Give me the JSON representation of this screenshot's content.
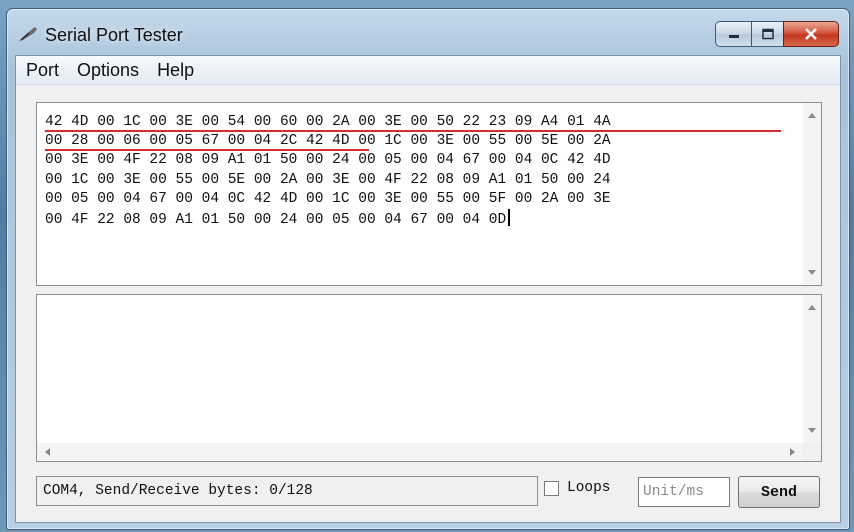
{
  "window": {
    "title": "Serial Port Tester"
  },
  "menu": [
    "Port",
    "Options",
    "Help"
  ],
  "receive_text": [
    "42 4D 00 1C 00 3E 00 54 00 60 00 2A 00 3E 00 50 22 23 09 A4 01 4A",
    "00 28 00 06 00 05 67 00 04 2C 42 4D 00 1C 00 3E 00 55 00 5E 00 2A",
    "00 3E 00 4F 22 08 09 A1 01 50 00 24 00 05 00 04 67 00 04 0C 42 4D",
    "00 1C 00 3E 00 55 00 5E 00 2A 00 3E 00 4F 22 08 09 A1 01 50 00 24",
    "00 05 00 04 67 00 04 0C 42 4D 00 1C 00 3E 00 55 00 5F 00 2A 00 3E",
    "00 4F 22 08 09 A1 01 50 00 24 00 05 00 04 67 00 04 0D"
  ],
  "send_text": "",
  "status": {
    "text": "COM4, Send/Receive bytes: 0/128"
  },
  "loops": {
    "label": "Loops",
    "checked": false
  },
  "unit": {
    "placeholder": "Unit/ms"
  },
  "send_button": {
    "label": "Send"
  },
  "colors": {
    "highlight_underline": "#d62e2e"
  }
}
